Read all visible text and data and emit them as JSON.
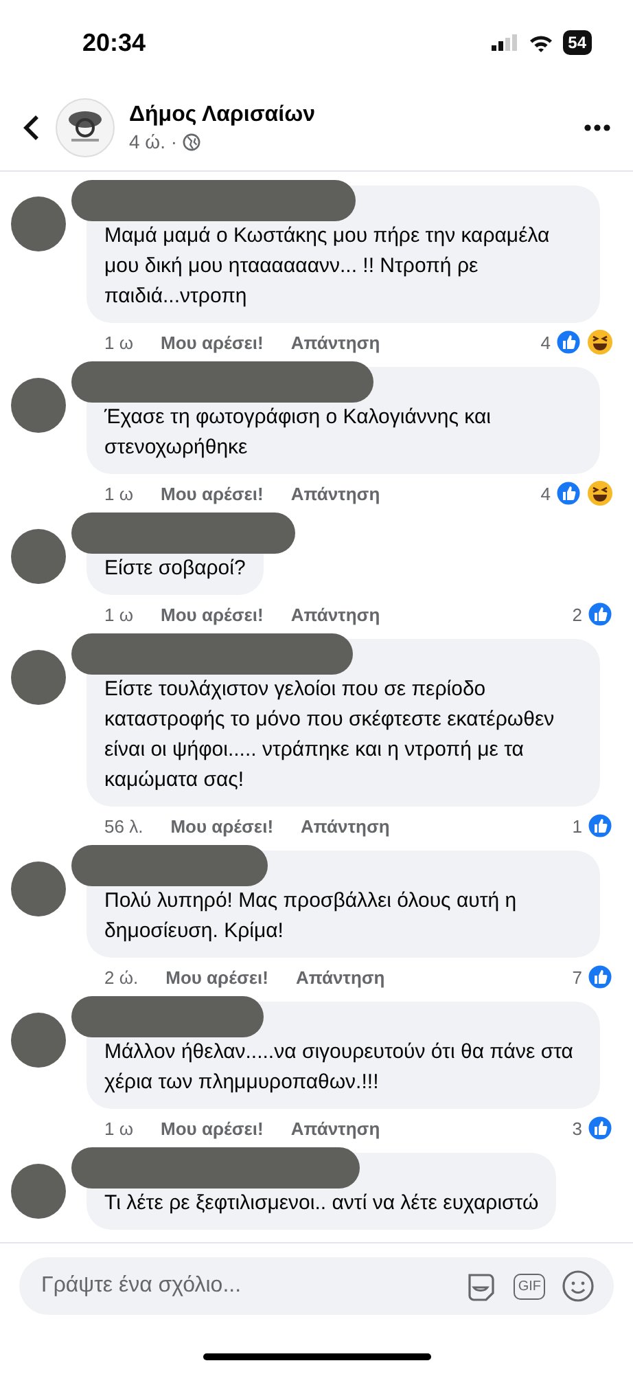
{
  "status_bar": {
    "time": "20:34",
    "battery": "54"
  },
  "post_header": {
    "page_name": "Δήμος Λαρισαίων",
    "meta": "4 ώ. ·"
  },
  "comments": [
    {
      "text": "Μαμά μαμά ο Κωστάκης μου πήρε την καραμέλα μου δική μου ηταααααανν... !! Ντροπή ρε παιδιά...ντροπη",
      "time": "1 ω",
      "like": "Μου αρέσει!",
      "reply": "Απάντηση",
      "count": "4",
      "reactions": [
        {
          "kind": "like"
        },
        {
          "kind": "haha"
        }
      ]
    },
    {
      "text": "Έχασε τη φωτογράφιση ο Καλογιάννης και στενοχωρήθηκε",
      "time": "1 ω",
      "like": "Μου αρέσει!",
      "reply": "Απάντηση",
      "count": "4",
      "reactions": [
        {
          "kind": "like"
        },
        {
          "kind": "haha"
        }
      ]
    },
    {
      "text": "Είστε σοβαροί?",
      "time": "1 ω",
      "like": "Μου αρέσει!",
      "reply": "Απάντηση",
      "count": "2",
      "reactions": [
        {
          "kind": "like"
        }
      ]
    },
    {
      "text": "Είστε τουλάχιστον γελοίοι που σε περίοδο καταστροφής το μόνο που σκέφτεστε εκατέρωθεν είναι οι ψήφοι..... ντράπηκε και η ντροπή με τα καμώματα σας!",
      "time": "56 λ.",
      "like": "Μου αρέσει!",
      "reply": "Απάντηση",
      "count": "1",
      "reactions": [
        {
          "kind": "like"
        }
      ]
    },
    {
      "text": "Πολύ λυπηρό! Μας προσβάλλει όλους αυτή η δημοσίευση. Κρίμα!",
      "time": "2 ώ.",
      "like": "Μου αρέσει!",
      "reply": "Απάντηση",
      "count": "7",
      "reactions": [
        {
          "kind": "like"
        }
      ]
    },
    {
      "text": "Μάλλον ήθελαν.....να σιγουρευτούν ότι θα πάνε στα χέρια των πλημμυροπαθων.!!!",
      "time": "1 ω",
      "like": "Μου αρέσει!",
      "reply": "Απάντηση",
      "count": "3",
      "reactions": [
        {
          "kind": "like"
        }
      ]
    },
    {
      "text": "Τι λέτε ρε ξεφτιλισμενοι.. αντί να λέτε ευχαριστώ"
    }
  ],
  "composer": {
    "placeholder": "Γράψτε ένα σχόλιο...",
    "gif": "GIF"
  }
}
